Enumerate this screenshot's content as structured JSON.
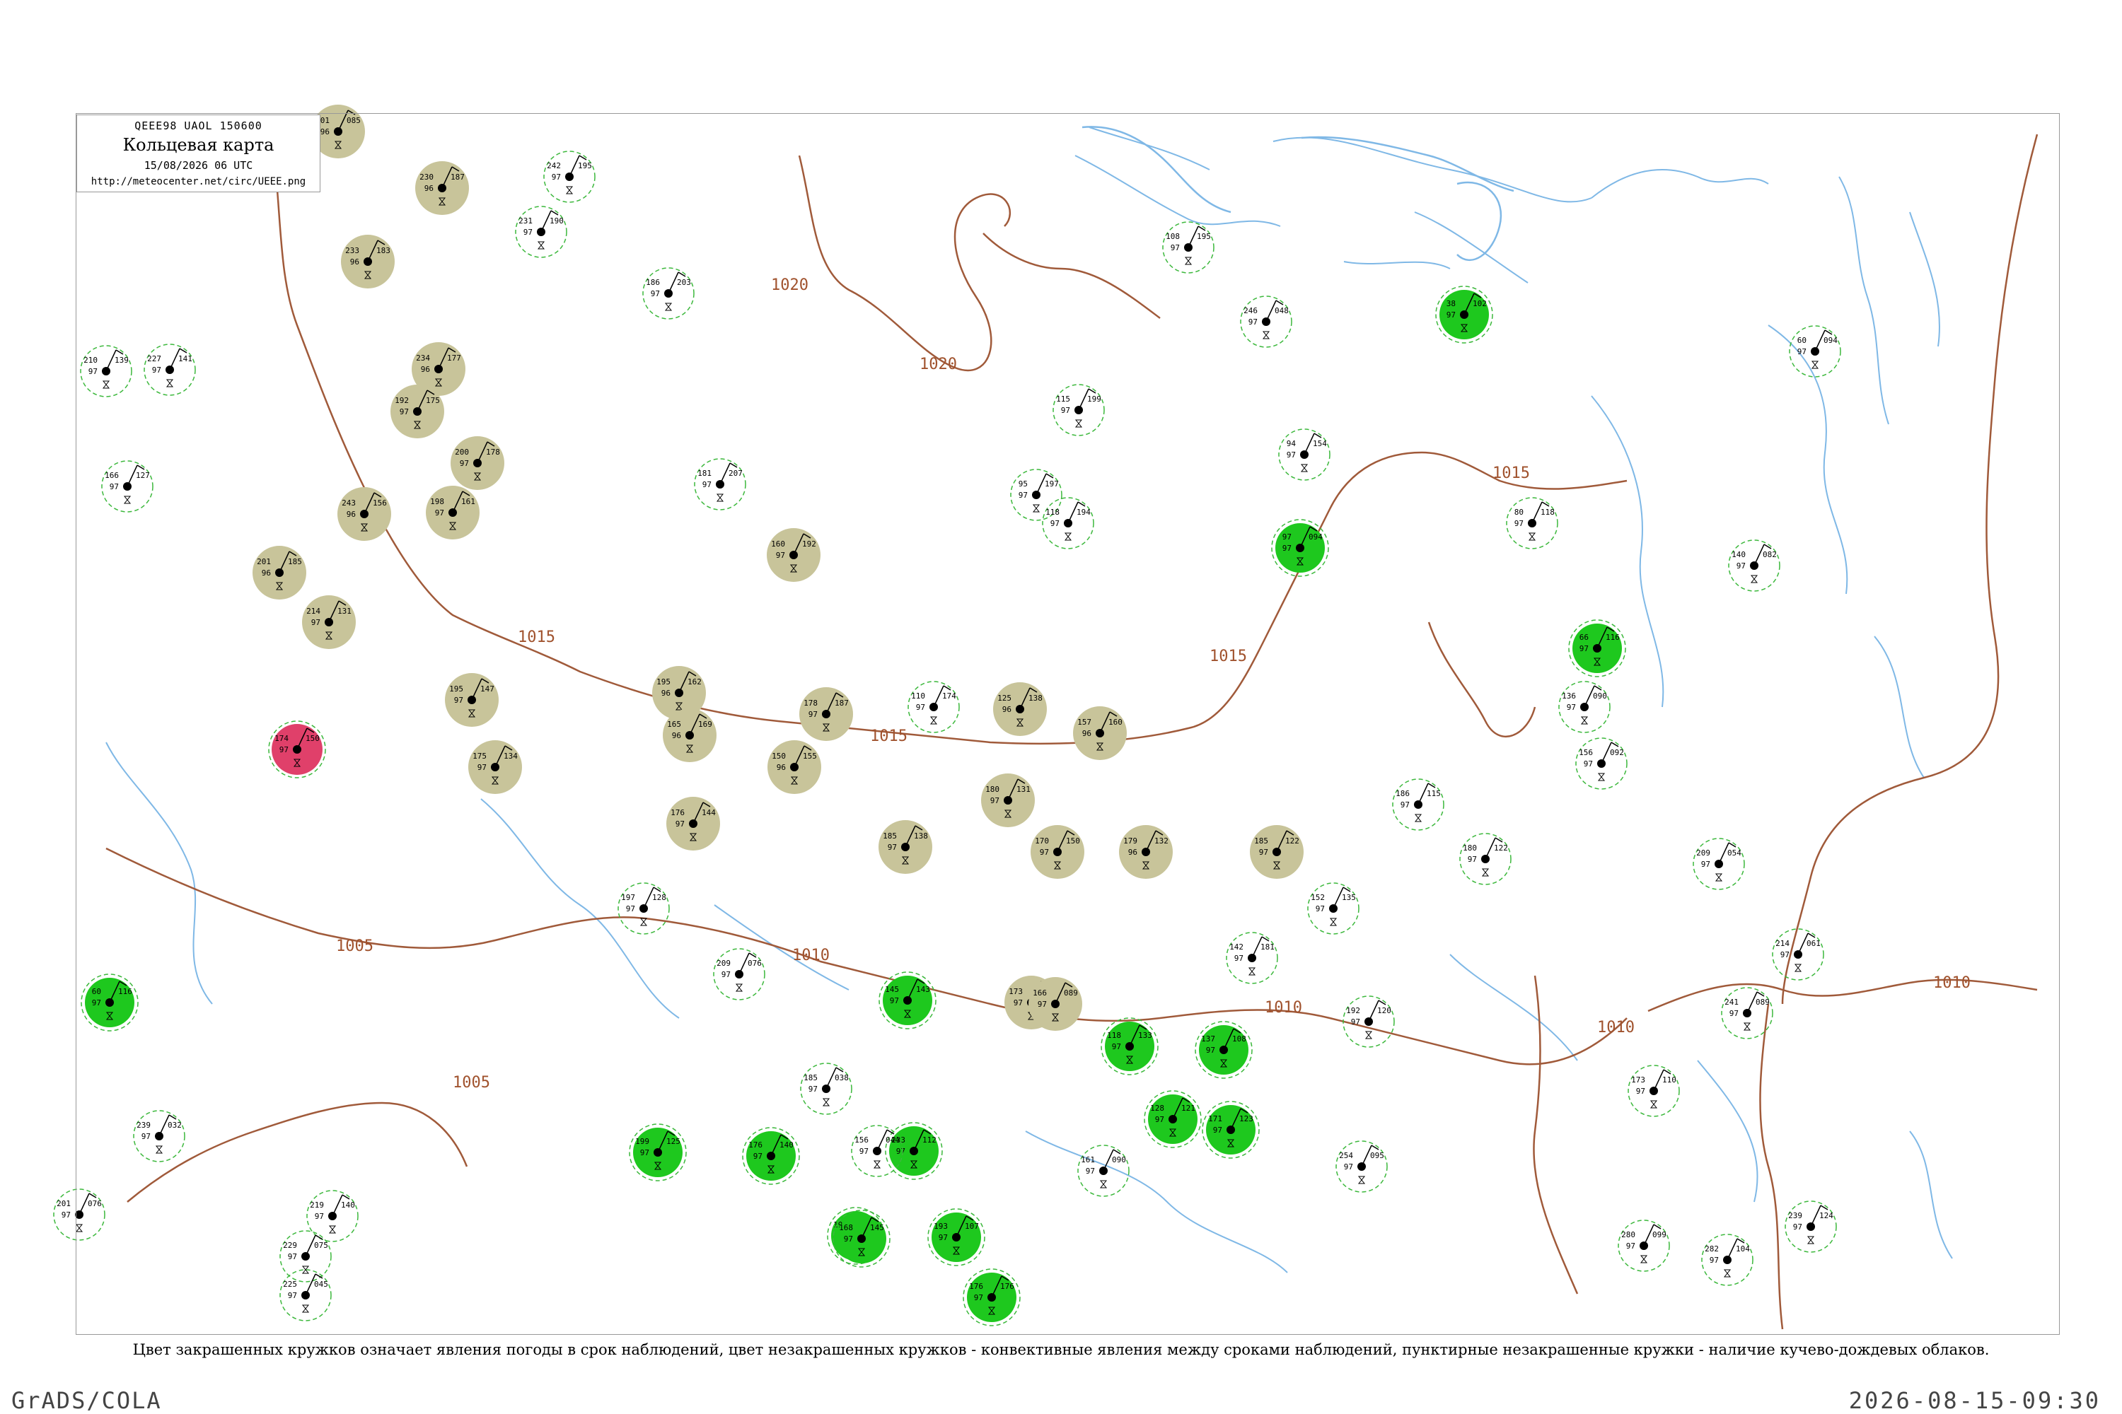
{
  "header": {
    "code": "QEEE98  UAOL  150600",
    "title": "Кольцевая карта",
    "date": "15/08/2026 06 UTC",
    "url": "http://meteocenter.net/circ/UEEE.png"
  },
  "caption": "Цвет закрашенных кружков означает явления погоды в срок наблюдений, цвет незакрашенных кружков - конвективные явления между сроками наблюдений, пунктирные незакрашенные кружки - наличие кучево-дождевых облаков.",
  "footer": {
    "left": "GrADS/COLA",
    "right": "2026-08-15-09:30"
  },
  "colors": {
    "isobar": "#a05a3a",
    "isobar_label": "#a0522d",
    "river": "#7fb8e6",
    "haze_fill": "#c8c49a",
    "rain_fill": "#1ec81e",
    "storm_fill": "#e0406a",
    "cb_ring": "#3cb83c",
    "station_label": "#777777",
    "frame": "#999999"
  },
  "isobar_labels": [
    "1020",
    "1020",
    "1015",
    "1015",
    "1015",
    "1015",
    "1010",
    "1010",
    "1010",
    "1010",
    "1005",
    "1005"
  ],
  "stations": [
    {
      "t": "201",
      "d": "96",
      "p": "085",
      "s": "haze"
    },
    {
      "t": "230",
      "d": "96",
      "p": "187",
      "s": "haze"
    },
    {
      "t": "233",
      "d": "96",
      "p": "183",
      "s": "haze"
    },
    {
      "t": "234",
      "d": "96",
      "p": "177",
      "s": "haze"
    },
    {
      "t": "192",
      "d": "97",
      "p": "175",
      "s": "haze"
    },
    {
      "t": "200",
      "d": "97",
      "p": "178",
      "s": "haze"
    },
    {
      "t": "198",
      "d": "97",
      "p": "161",
      "s": "haze"
    },
    {
      "t": "243",
      "d": "96",
      "p": "156",
      "s": "haze"
    },
    {
      "t": "201",
      "d": "96",
      "p": "185",
      "s": "haze"
    },
    {
      "t": "214",
      "d": "97",
      "p": "131",
      "s": "haze"
    },
    {
      "t": "195",
      "d": "96",
      "p": "162",
      "s": "haze"
    },
    {
      "t": "165",
      "d": "96",
      "p": "169",
      "s": "haze"
    },
    {
      "t": "195",
      "d": "97",
      "p": "147",
      "s": "haze"
    },
    {
      "t": "175",
      "d": "97",
      "p": "134",
      "s": "haze"
    },
    {
      "t": "176",
      "d": "97",
      "p": "144",
      "s": "haze"
    },
    {
      "t": "160",
      "d": "97",
      "p": "192",
      "s": "haze"
    },
    {
      "t": "178",
      "d": "97",
      "p": "187",
      "s": "haze"
    },
    {
      "t": "150",
      "d": "96",
      "p": "155",
      "s": "haze"
    },
    {
      "t": "125",
      "d": "96",
      "p": "138",
      "s": "haze"
    },
    {
      "t": "157",
      "d": "96",
      "p": "160",
      "s": "haze"
    },
    {
      "t": "180",
      "d": "97",
      "p": "131",
      "s": "haze"
    },
    {
      "t": "185",
      "d": "97",
      "p": "138",
      "s": "haze"
    },
    {
      "t": "170",
      "d": "97",
      "p": "150",
      "s": "haze"
    },
    {
      "t": "179",
      "d": "96",
      "p": "132",
      "s": "haze"
    },
    {
      "t": "185",
      "d": "97",
      "p": "122",
      "s": "haze"
    },
    {
      "t": "173",
      "d": "97",
      "p": "091",
      "s": "haze"
    },
    {
      "t": "166",
      "d": "97",
      "p": "089",
      "s": "haze"
    },
    {
      "t": "38",
      "d": "97",
      "p": "102",
      "s": "rain"
    },
    {
      "t": "60",
      "d": "97",
      "p": "116",
      "s": "rain"
    },
    {
      "t": "97",
      "d": "97",
      "p": "094",
      "s": "rain"
    },
    {
      "t": "66",
      "d": "97",
      "p": "116",
      "s": "rain"
    },
    {
      "t": "145",
      "d": "97",
      "p": "143",
      "s": "rain"
    },
    {
      "t": "118",
      "d": "97",
      "p": "133",
      "s": "rain"
    },
    {
      "t": "137",
      "d": "97",
      "p": "108",
      "s": "rain"
    },
    {
      "t": "128",
      "d": "97",
      "p": "121",
      "s": "rain"
    },
    {
      "t": "171",
      "d": "97",
      "p": "123",
      "s": "rain"
    },
    {
      "t": "233",
      "d": "97",
      "p": "112",
      "s": "rain"
    },
    {
      "t": "193",
      "d": "97",
      "p": "107",
      "s": "rain"
    },
    {
      "t": "176",
      "d": "97",
      "p": "176",
      "s": "rain"
    },
    {
      "t": "194",
      "d": "97",
      "p": "166",
      "s": "rain"
    },
    {
      "t": "199",
      "d": "97",
      "p": "125",
      "s": "rain"
    },
    {
      "t": "176",
      "d": "97",
      "p": "140",
      "s": "rain"
    },
    {
      "t": "168",
      "d": "97",
      "p": "145",
      "s": "rain"
    },
    {
      "t": "174",
      "d": "97",
      "p": "150",
      "s": "storm"
    },
    {
      "t": "94",
      "d": "97",
      "p": "154",
      "s": "plain"
    },
    {
      "t": "80",
      "d": "97",
      "p": "118",
      "s": "plain"
    },
    {
      "t": "140",
      "d": "97",
      "p": "082",
      "s": "plain"
    },
    {
      "t": "60",
      "d": "97",
      "p": "094",
      "s": "plain"
    },
    {
      "t": "136",
      "d": "97",
      "p": "090",
      "s": "plain"
    },
    {
      "t": "110",
      "d": "97",
      "p": "174",
      "s": "plain"
    },
    {
      "t": "246",
      "d": "97",
      "p": "048",
      "s": "plain"
    },
    {
      "t": "108",
      "d": "97",
      "p": "195",
      "s": "plain"
    },
    {
      "t": "115",
      "d": "97",
      "p": "199",
      "s": "plain"
    },
    {
      "t": "186",
      "d": "97",
      "p": "115",
      "s": "plain"
    },
    {
      "t": "180",
      "d": "97",
      "p": "122",
      "s": "plain"
    },
    {
      "t": "209",
      "d": "97",
      "p": "054",
      "s": "plain"
    },
    {
      "t": "192",
      "d": "97",
      "p": "120",
      "s": "plain"
    },
    {
      "t": "239",
      "d": "97",
      "p": "124",
      "s": "plain"
    },
    {
      "t": "282",
      "d": "97",
      "p": "104",
      "s": "plain"
    },
    {
      "t": "254",
      "d": "97",
      "p": "095",
      "s": "plain"
    },
    {
      "t": "219",
      "d": "97",
      "p": "140",
      "s": "plain"
    },
    {
      "t": "210",
      "d": "97",
      "p": "139",
      "s": "plain"
    },
    {
      "t": "166",
      "d": "97",
      "p": "127",
      "s": "plain"
    },
    {
      "t": "227",
      "d": "97",
      "p": "141",
      "s": "plain"
    },
    {
      "t": "242",
      "d": "97",
      "p": "195",
      "s": "plain"
    },
    {
      "t": "231",
      "d": "97",
      "p": "190",
      "s": "plain"
    },
    {
      "t": "181",
      "d": "97",
      "p": "207",
      "s": "plain"
    },
    {
      "t": "186",
      "d": "97",
      "p": "203",
      "s": "plain"
    },
    {
      "t": "95",
      "d": "97",
      "p": "197",
      "s": "plain"
    },
    {
      "t": "118",
      "d": "97",
      "p": "194",
      "s": "plain"
    },
    {
      "t": "197",
      "d": "97",
      "p": "128",
      "s": "plain"
    },
    {
      "t": "209",
      "d": "97",
      "p": "076",
      "s": "plain"
    },
    {
      "t": "185",
      "d": "97",
      "p": "038",
      "s": "plain"
    },
    {
      "t": "156",
      "d": "97",
      "p": "044",
      "s": "plain"
    },
    {
      "t": "161",
      "d": "97",
      "p": "090",
      "s": "plain"
    },
    {
      "t": "229",
      "d": "97",
      "p": "075",
      "s": "plain"
    },
    {
      "t": "225",
      "d": "97",
      "p": "045",
      "s": "plain"
    },
    {
      "t": "239",
      "d": "97",
      "p": "032",
      "s": "plain"
    },
    {
      "t": "201",
      "d": "97",
      "p": "076",
      "s": "plain"
    },
    {
      "t": "142",
      "d": "97",
      "p": "181",
      "s": "plain"
    },
    {
      "t": "152",
      "d": "97",
      "p": "135",
      "s": "plain"
    },
    {
      "t": "280",
      "d": "97",
      "p": "099",
      "s": "plain"
    },
    {
      "t": "214",
      "d": "97",
      "p": "061",
      "s": "plain"
    },
    {
      "t": "173",
      "d": "97",
      "p": "110",
      "s": "plain"
    },
    {
      "t": "241",
      "d": "97",
      "p": "089",
      "s": "plain"
    },
    {
      "t": "156",
      "d": "97",
      "p": "092",
      "s": "plain"
    }
  ]
}
